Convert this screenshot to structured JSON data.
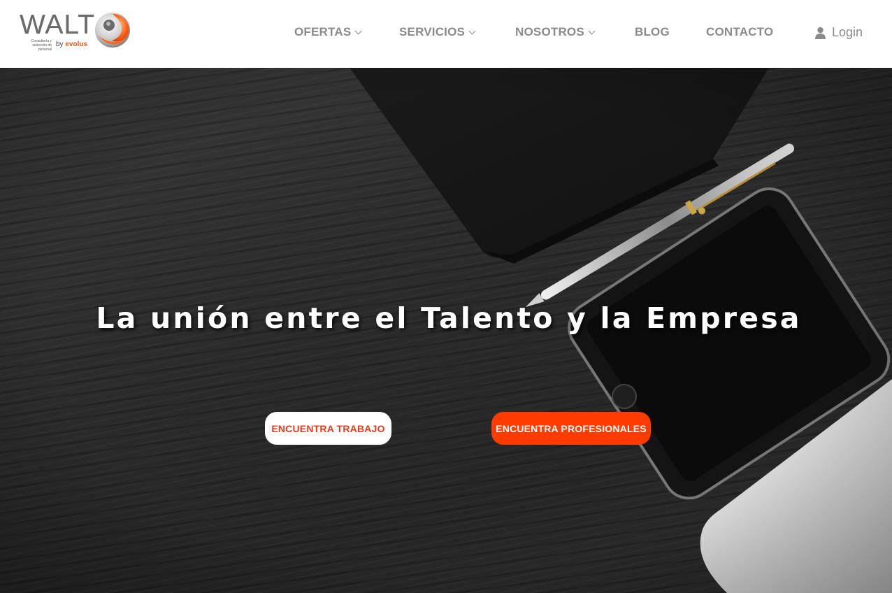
{
  "header": {
    "logo": {
      "wordmark": "WALT",
      "tagline": "Consultoría y selección de personal",
      "by": "by",
      "brand": "evolus"
    },
    "nav": [
      {
        "label": "OFERTAS",
        "has_dropdown": true
      },
      {
        "label": "SERVICIOS",
        "has_dropdown": true
      },
      {
        "label": "NOSOTROS",
        "has_dropdown": true
      },
      {
        "label": "BLOG",
        "has_dropdown": false
      },
      {
        "label": "CONTACTO",
        "has_dropdown": false
      }
    ],
    "login": {
      "label": "Login",
      "icon": "user-icon"
    }
  },
  "hero": {
    "title": "La unión entre el Talento y la Empresa",
    "buttons": {
      "find_job": "ENCUENTRA TRABAJO",
      "find_professionals": "ENCUENTRA PROFESIONALES"
    }
  },
  "colors": {
    "accent": "#ff3c00",
    "nav_text": "#8a8a8a",
    "header_bg": "#ffffff"
  }
}
